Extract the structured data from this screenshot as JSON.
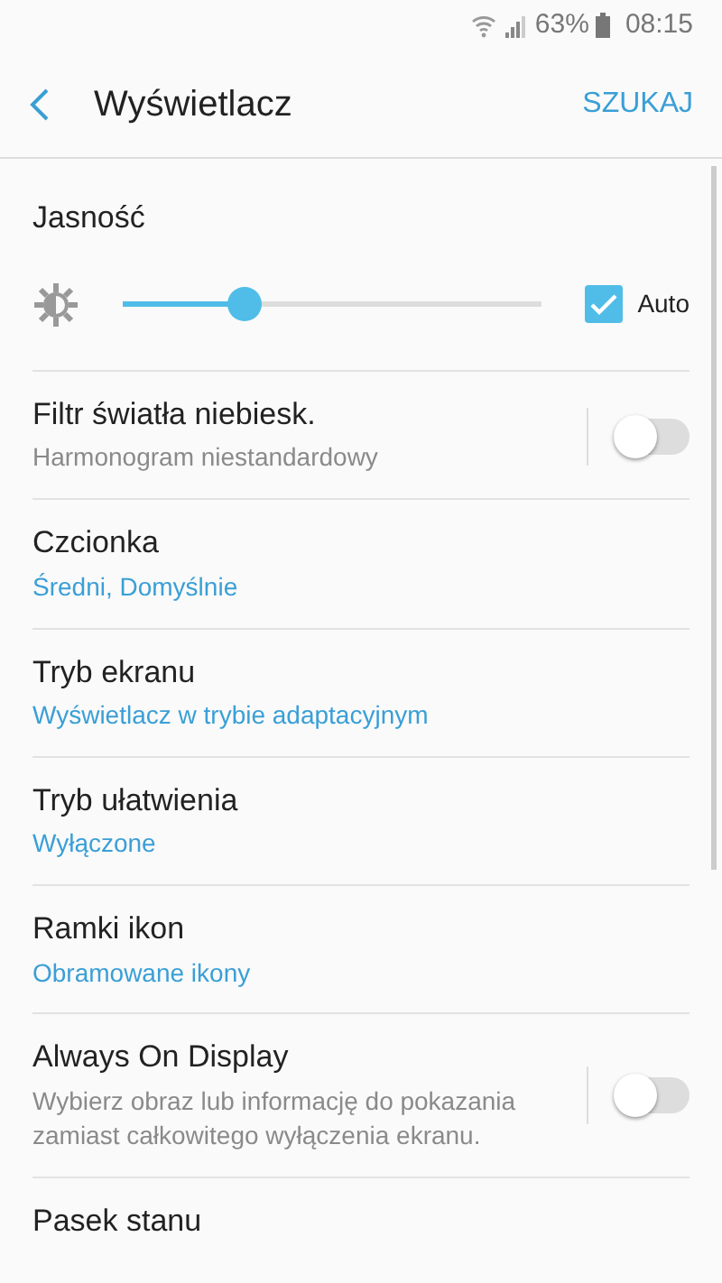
{
  "status_bar": {
    "battery": "63%",
    "time": "08:15"
  },
  "header": {
    "title": "Wyświetlacz",
    "action": "SZUKAJ"
  },
  "brightness": {
    "title": "Jasność",
    "level": 0.29,
    "auto_label": "Auto",
    "auto_checked": true
  },
  "items": [
    {
      "kind": "toggle",
      "title": "Filtr światła niebiesk.",
      "subtitle": "Harmonogram niestandardowy",
      "on": false
    },
    {
      "kind": "value",
      "title": "Czcionka",
      "subtitle": "Średni, Domyślnie"
    },
    {
      "kind": "value",
      "title": "Tryb ekranu",
      "subtitle": "Wyświetlacz w trybie adaptacyjnym"
    },
    {
      "kind": "value",
      "title": "Tryb ułatwienia",
      "subtitle": "Wyłączone"
    },
    {
      "kind": "value",
      "title": "Ramki ikon",
      "subtitle": "Obramowane ikony"
    },
    {
      "kind": "toggle",
      "title": "Always On Display",
      "subtitle": "Wybierz obraz lub informację do pokazania zamiast całkowitego wyłączenia ekranu.",
      "on": false
    },
    {
      "kind": "value",
      "title": "Pasek stanu"
    }
  ]
}
